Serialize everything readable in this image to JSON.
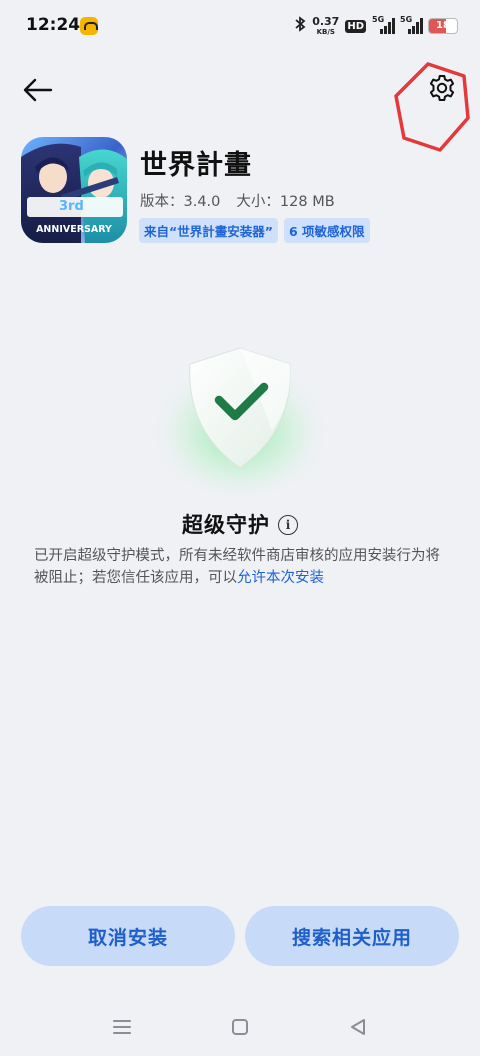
{
  "status_bar": {
    "time": "12:24",
    "net_speed_value": "0.37",
    "net_speed_unit": "KB/S",
    "hd_label": "HD",
    "signal1_label": "5G",
    "signal2_label": "5G",
    "battery_level": "18"
  },
  "header": {
    "back_icon": "arrow-left-icon",
    "settings_icon": "gear-icon",
    "highlight_color": "#e5383b"
  },
  "app": {
    "name": "世界計畫",
    "version": "版本：3.4.0",
    "size": "大小：128 MB",
    "source_tag": "来自“世界計畫安装器”",
    "permissions_tag": "6 项敏感权限",
    "icon_banner_text": "ANNIVERSARY",
    "icon_number_text": "3rd"
  },
  "protection": {
    "title": "超级守护",
    "info_icon": "info-icon",
    "description": "已开启超级守护模式，所有未经软件商店审核的应用安装行为将被阻止；若您信任该应用，可以",
    "allow_link": "允许本次安装"
  },
  "buttons": {
    "cancel": "取消安装",
    "search": "搜索相关应用"
  },
  "nav_bar": {
    "menu_icon": "menu-icon",
    "home_icon": "home-square-icon",
    "back_icon": "back-triangle-icon"
  },
  "colors": {
    "accent": "#1f63d6",
    "button_bg": "#c7daf7",
    "background": "#eff1f5",
    "shield_check": "#1e7b45"
  }
}
